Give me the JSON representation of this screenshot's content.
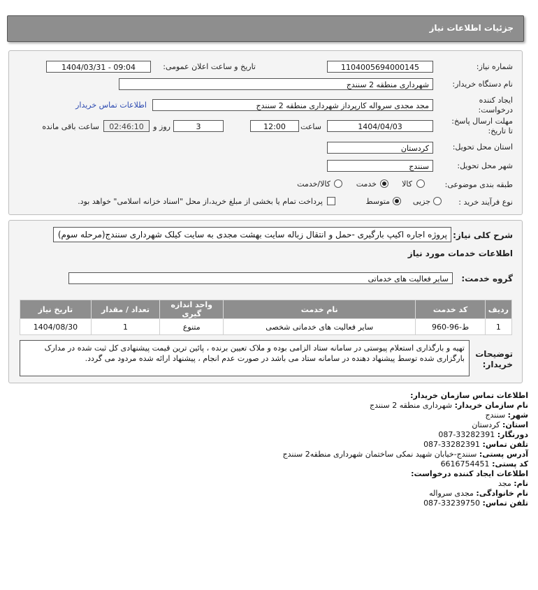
{
  "header": {
    "title": "جزئیات اطلاعات نیاز"
  },
  "form": {
    "need_number_label": "شماره نیاز:",
    "need_number": "1104005694000145",
    "announce_label": "تاریخ و ساعت اعلان عمومی:",
    "announce_value": "1404/03/31 - 09:04",
    "buyer_org_label": "نام دستگاه خریدار:",
    "buyer_org": "شهرداری منطقه 2 سنندج",
    "creator_label": "ایجاد کننده درخواست:",
    "creator": "مجد مجدی سرواله کارپرداز شهرداری منطقه 2 سنندج",
    "buyer_contact_link": "اطلاعات تماس خریدار",
    "deadline_label": "مهلت ارسال پاسخ: تا تاریخ:",
    "deadline_date": "1404/04/03",
    "time_label": "ساعت",
    "deadline_time": "12:00",
    "days_value": "3",
    "days_label": "روز و",
    "remaining_time": "02:46:10",
    "remaining_label": "ساعت باقی مانده",
    "province_label": "استان محل تحویل:",
    "province": "کردستان",
    "city_label": "شهر محل تحویل:",
    "city": "سنندج",
    "category_label": "طبقه بندی موضوعی:",
    "category_options": [
      "کالا",
      "خدمت",
      "کالا/خدمت"
    ],
    "category_selected": "خدمت",
    "purchase_type_label": "نوع فرآیند خرید :",
    "purchase_options": [
      "جزیی",
      "متوسط"
    ],
    "purchase_selected": "متوسط",
    "payment_note": "پرداخت تمام یا بخشی از مبلغ خرید،از محل \"اسناد خزانه اسلامی\" خواهد بود."
  },
  "details": {
    "summary_label": "شرح کلی نیاز:",
    "summary": "پروژه اجاره اکیپ بارگیری -حمل و انتقال زباله سایت بهشت مجدی به سایت کیلک شهرداری سنندج(مرحله سوم)",
    "services_heading": "اطلاعات خدمات مورد نیاز",
    "service_group_label": "گروه خدمت:",
    "service_group": "سایر فعالیت های خدماتی",
    "table": {
      "headers": [
        "ردیف",
        "کد خدمت",
        "نام خدمت",
        "واحد اندازه گیری",
        "تعداد / مقدار",
        "تاریخ نیاز"
      ],
      "rows": [
        [
          "1",
          "ط-96-960",
          "سایر فعالیت های خدماتی شخصی",
          "متنوع",
          "1",
          "1404/08/30"
        ]
      ]
    },
    "buyer_notes_label": "توضیحات خریدار:",
    "buyer_notes": "تهیه و بارگذاری استعلام پیوستی در سامانه ستاد الزامی بوده و ملاک تعیین برنده ، پائین ترین قیمت پیشنهادی کل ثبت شده در مدارک بارگزاری شده توسط پیشنهاد دهنده در سامانه ستاد می باشد در صورت عدم انجام ، پیشنهاد ارائه شده مردود می گردد."
  },
  "contact": {
    "heading": "اطلاعات تماس سازمان خریدار:",
    "org_label": "نام سازمان خریدار:",
    "org": "شهرداری منطقه 2 سنندج",
    "city_label": "شهر:",
    "city": "سنندج",
    "province_label": "استان:",
    "province": "کردستان",
    "fax_label": "دورنگار:",
    "fax": "087-33282391",
    "phone_label": "تلفن تماس:",
    "phone": "087-33282391",
    "address_label": "آدرس پستی:",
    "address": "سنندج-خیابان شهید نمکی ساختمان شهرداری منطقه2 سنندج",
    "postal_label": "کد پستی:",
    "postal": "6616754451",
    "creator_heading": "اطلاعات ایجاد کننده درخواست:",
    "first_name_label": "نام:",
    "first_name": "مجد",
    "last_name_label": "نام خانوادگی:",
    "last_name": "مجدی سرواله",
    "creator_phone_label": "تلفن تماس:",
    "creator_phone": "087-33239750"
  }
}
